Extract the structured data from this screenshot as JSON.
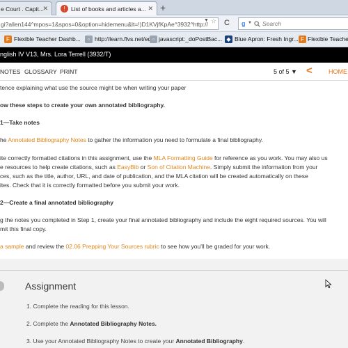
{
  "browser": {
    "tabs": [
      {
        "label": "e Court . Capit...",
        "close": "✕"
      },
      {
        "label": "List of books and articles a...",
        "close": "✕"
      }
    ],
    "new_tab": "+",
    "url": "gi?allen144^mpos=1&spos=0&option=hidemenu&lt=!)D1KVjfKpAe^3932^http://",
    "url_dropdown": "▼",
    "star": "☆",
    "reload": "C",
    "search_engine_letter": "g",
    "search_placeholder": "Search",
    "bookmarks": [
      {
        "label": "Flexible Teacher Dashb..."
      },
      {
        "label": "http://learn.flvs.net/ed..."
      },
      {
        "label": "javascript:_doPostBac..."
      },
      {
        "label": "Blue Apron: Fresh Ingr..."
      },
      {
        "label": "Flexible Teache"
      }
    ]
  },
  "course": {
    "title": "nglish IV V13, Mrs. Lora Terrell (3932/T)"
  },
  "toolbar": {
    "notes": "NOTES",
    "glossary": "GLOSSARY",
    "print": "PRINT",
    "pager": "5 of 5 ▼",
    "home": "HOME"
  },
  "content": {
    "line0": "tence explaining what use the source might be when writing your paper",
    "steps_intro": "ow these steps to create your own annotated bibliography.",
    "step1_heading": "1—Take notes",
    "step1_pre": "he ",
    "step1_link": "Annotated Bibliography Notes",
    "step1_post": " to gather the information you need to formulate a final bibliography.",
    "s1b_l1_pre": "ite correctly formatted citations in this assignment, use the ",
    "s1b_l1_link": "MLA Formatting Guide",
    "s1b_l1_post": " for reference as you work. You may also us",
    "s1b_l2_pre": "e resources to help create citations, such as ",
    "s1b_l2_link1": "EasyBib",
    "s1b_l2_mid": " or ",
    "s1b_l2_link2": "Son of Citation Machine",
    "s1b_l2_post": ". Simply submit the information from your",
    "s1b_l3": "ces, such as the title, author, URL, and date of publication, and the MLA citation will be created automatically on these",
    "s1b_l4": "ites. Check that it is correctly formatted before you submit your work.",
    "step2_heading": "2—Create a final annotated bibliography",
    "s2_l1": "g the notes you completed in Step 1, create your final annotated bibliography and include the eight required sources. You will",
    "s2_l2": "mit this final copy.",
    "s3_link1": " a sample",
    "s3_mid": " and review the ",
    "s3_link2": "02.06 Prepping Your Sources rubric",
    "s3_post": " to see how you'll be graded for your work."
  },
  "assignment": {
    "title": "Assignment",
    "step1": "1.  Complete the reading for this lesson.",
    "step2_pre": "2.  Complete the ",
    "step2_bold": "Annotated Bibliography Notes.",
    "step3_pre": "3.  Use your Annotated Bibliography Notes to create your ",
    "step3_bold": "Annotated Bibliography",
    "step3_post": "."
  },
  "colors": {
    "accent": "#e8761c",
    "link": "#e0861a",
    "header_bg": "#000000"
  }
}
